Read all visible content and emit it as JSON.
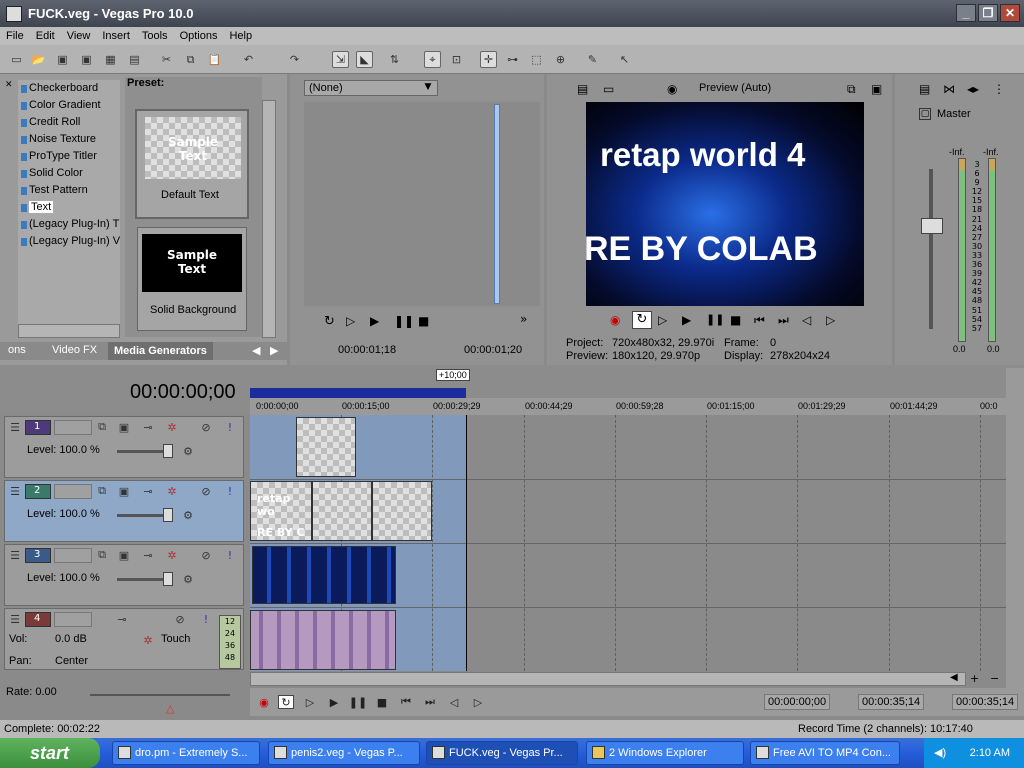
{
  "window": {
    "title": "FUCK.veg - Vegas Pro 10.0"
  },
  "menu": [
    "File",
    "Edit",
    "View",
    "Insert",
    "Tools",
    "Options",
    "Help"
  ],
  "generators": {
    "items": [
      "Checkerboard",
      "Color Gradient",
      "Credit Roll",
      "Noise Texture",
      "ProType Titler",
      "Solid Color",
      "Test Pattern",
      "Text",
      "(Legacy Plug-In) T",
      "(Legacy Plug-In) V"
    ],
    "selected": "Text",
    "preset_label": "Preset:",
    "presets": [
      {
        "label": "Default Text",
        "sample": "Sample\nText"
      },
      {
        "label": "Solid Background",
        "sample": "Sample\nText"
      }
    ],
    "tabs": [
      "ons",
      "Video FX",
      "Media Generators"
    ]
  },
  "trimmer": {
    "source": "(None)",
    "time_in": "00:00:01;18",
    "time_out": "00:00:01;20"
  },
  "preview": {
    "mode": "Preview (Auto)",
    "text_line1": "retap world 4",
    "text_line2": "RE BY COLAB",
    "project_label": "Project:",
    "project_value": "720x480x32, 29.970i",
    "preview_label": "Preview:",
    "preview_value": "180x120, 29.970p",
    "frame_label": "Frame:",
    "frame_value": "0",
    "display_label": "Display:",
    "display_value": "278x204x24"
  },
  "mixer": {
    "title": "Master",
    "inf_left": "-Inf.",
    "inf_right": "-Inf.",
    "scale": [
      "3",
      "6",
      "9",
      "12",
      "15",
      "18",
      "21",
      "24",
      "27",
      "30",
      "33",
      "36",
      "39",
      "42",
      "45",
      "48",
      "51",
      "54",
      "57"
    ],
    "bottom_left": "0.0",
    "bottom_right": "0.0"
  },
  "timeline": {
    "cursor_time": "00:00:00;00",
    "zoom_badge": "+10;00",
    "ruler": [
      "0:00:00;00",
      "00:00:15;00",
      "00:00:29;29",
      "00:00:44;29",
      "00:00:59;28",
      "00:01:15;00",
      "00:01:29;29",
      "00:01:44;29",
      "00:0"
    ],
    "tracks": [
      {
        "num": "1",
        "level": "Level: 100.0 %"
      },
      {
        "num": "2",
        "level": "Level: 100.0 %"
      },
      {
        "num": "3",
        "level": "Level: 100.0 %"
      }
    ],
    "audio": {
      "num": "4",
      "vol_label": "Vol:",
      "vol_value": "0.0 dB",
      "pan_label": "Pan:",
      "pan_value": "Center",
      "mode": "Touch",
      "meter": [
        "12",
        "24",
        "36",
        "48"
      ]
    },
    "clip2_text_a": "retap wo",
    "clip2_text_b": "RE BY C",
    "rate": "Rate: 0.00"
  },
  "transport": {
    "t1": "00:00:00;00",
    "t2": "00:00:35;14",
    "t3": "00:00:35;14"
  },
  "status": {
    "left": "Complete: 00:02:22",
    "right": "Record Time (2 channels): 10:17:40"
  },
  "taskbar": {
    "start": "start",
    "tasks": [
      "dro.pm - Extremely S...",
      "penis2.veg - Vegas P...",
      "FUCK.veg - Vegas Pr...",
      "2 Windows Explorer",
      "Free AVI TO MP4 Con..."
    ],
    "clock": "2:10 AM"
  }
}
